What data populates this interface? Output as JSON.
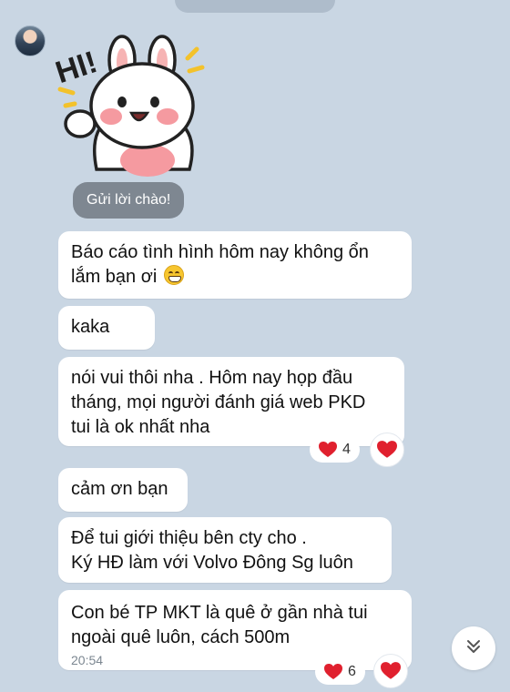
{
  "sticker": {
    "text": "HI!"
  },
  "greeting_button": {
    "label": "Gửi lời chào!"
  },
  "messages": [
    {
      "text_line1": "Báo cáo tình hình hôm nay không ổn",
      "text_line2": "lắm bạn ơi"
    },
    {
      "text": "kaka"
    },
    {
      "text_line1": "nói vui thôi nha . Hôm nay họp đầu",
      "text_line2": "tháng, mọi người đánh giá web PKD",
      "text_line3": "tui là ok nhất nha",
      "reaction_count": "4"
    },
    {
      "text": "cảm ơn bạn"
    },
    {
      "text_line1": "Để tui giới thiệu bên cty cho .",
      "text_line2": "Ký HĐ làm với Volvo Đông Sg luôn"
    },
    {
      "text_line1": "Con bé TP MKT là quê ở gần nhà tui",
      "text_line2": "ngoài quê luôn, cách 500m",
      "time": "20:54",
      "reaction_count": "6"
    }
  ],
  "colors": {
    "background": "#c9d6e3",
    "heart": "#e0202e",
    "bubble": "#ffffff"
  },
  "icons": {
    "reaction": "heart-icon",
    "scroll": "chevron-down-double-icon"
  }
}
